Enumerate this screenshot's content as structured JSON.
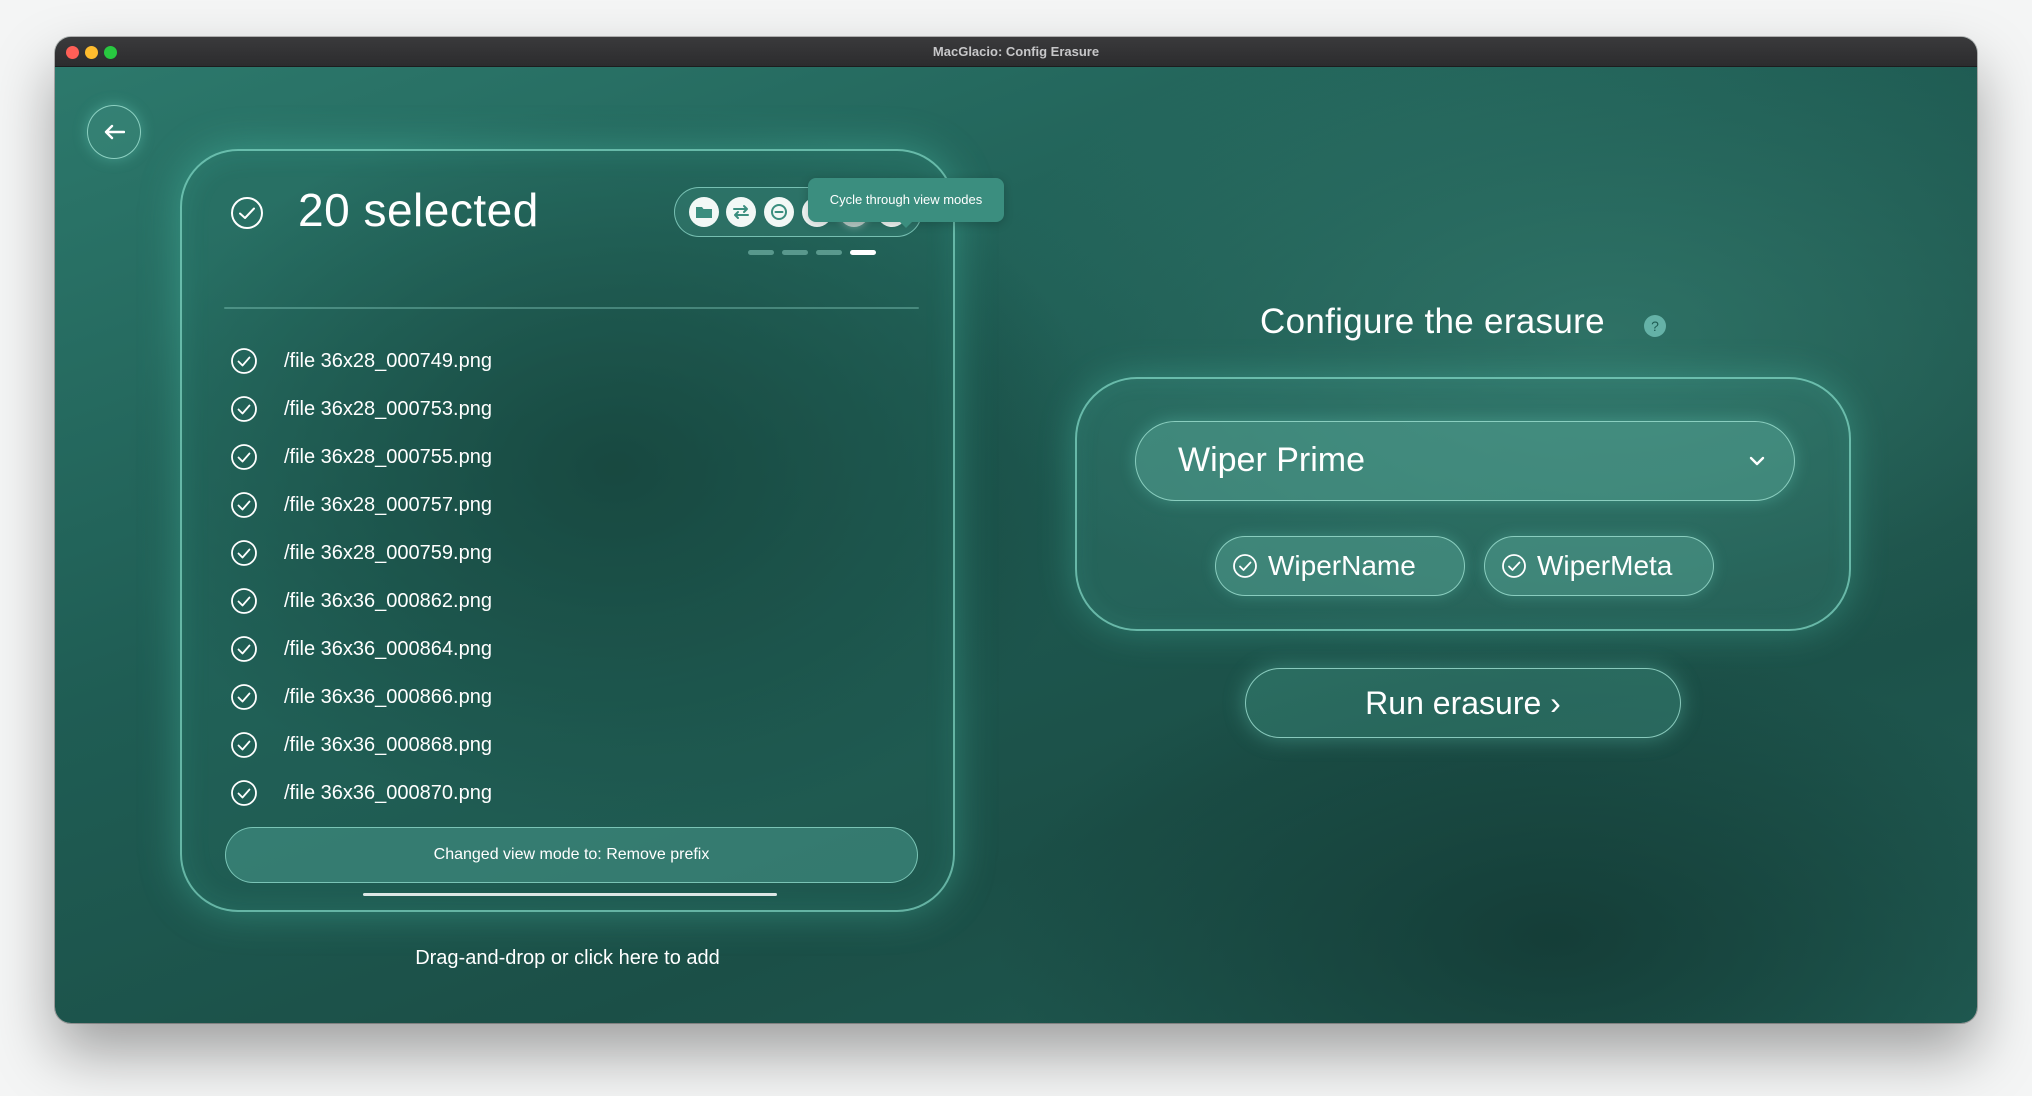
{
  "window": {
    "title": "MacGlacio: Config Erasure"
  },
  "selection": {
    "count_label": "20 selected",
    "toolbar_buttons": [
      "folder-icon",
      "swap-icon",
      "minus-circle-icon",
      "expand-vertical-icon",
      "eye-icon",
      "focus-frame-icon"
    ],
    "tooltip": "Cycle through view modes",
    "view_mode_active_index": 3,
    "view_mode_count": 4,
    "files": [
      "/file 36x28_000749.png",
      "/file 36x28_000753.png",
      "/file 36x28_000755.png",
      "/file 36x28_000757.png",
      "/file 36x28_000759.png",
      "/file 36x36_000862.png",
      "/file 36x36_000864.png",
      "/file 36x36_000866.png",
      "/file 36x36_000868.png",
      "/file 36x36_000870.png"
    ],
    "status": "Changed view mode to: Remove prefix",
    "drop_hint": "Drag-and-drop or click here to add"
  },
  "config": {
    "title": "Configure the erasure",
    "help_glyph": "?",
    "wiper_selected": "Wiper Prime",
    "options": [
      {
        "label": "WiperName",
        "checked": true
      },
      {
        "label": "WiperMeta",
        "checked": true
      }
    ],
    "run_label": "Run erasure ›"
  },
  "colors": {
    "accent": "#3b8e7f",
    "background": "#1f5d54",
    "glow": "#8ce6d2"
  }
}
